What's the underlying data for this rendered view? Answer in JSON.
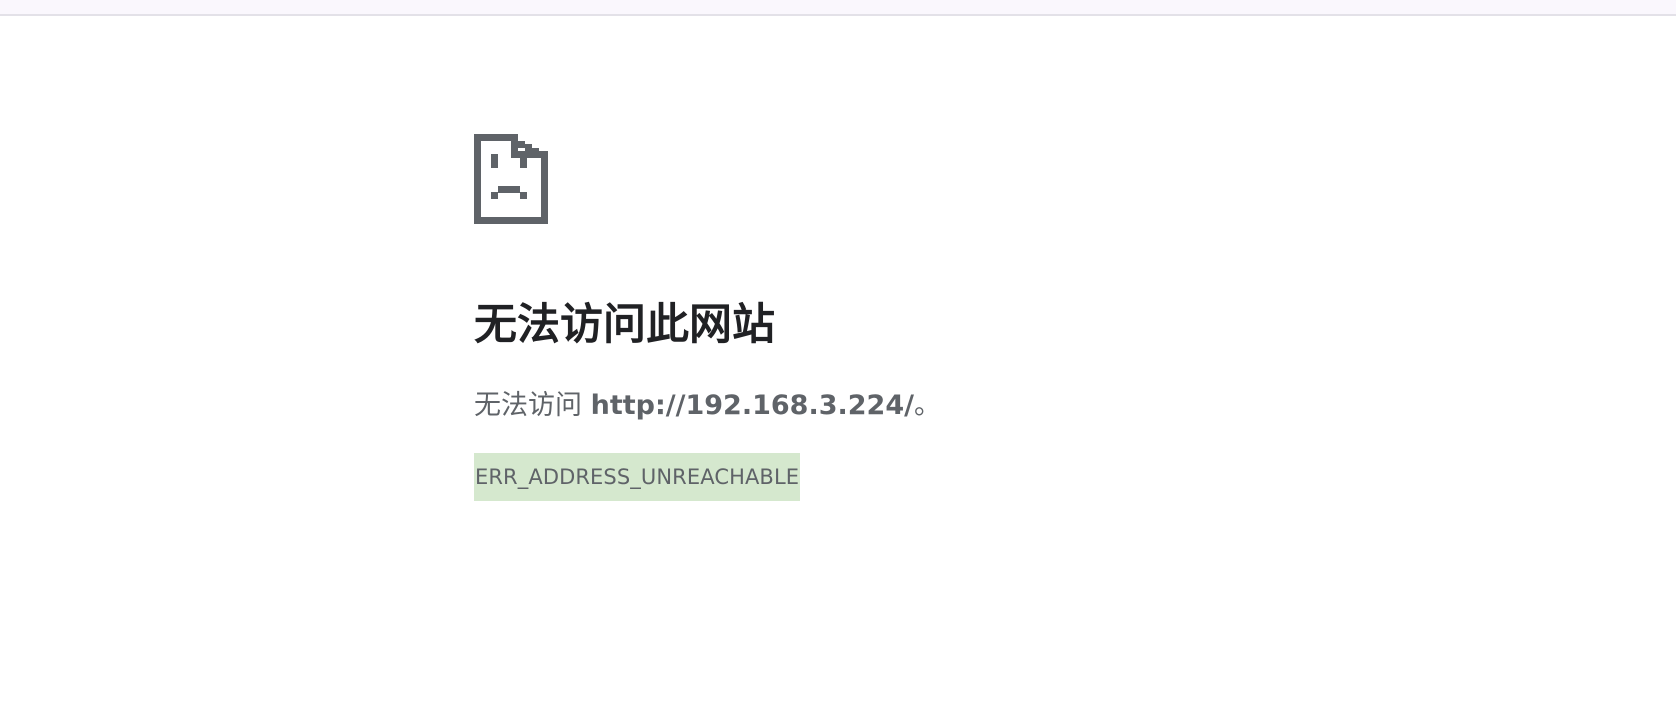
{
  "error_page": {
    "icon": "sad-page-icon",
    "title": "无法访问此网站",
    "message_prefix": "无法访问 ",
    "message_url": "http://192.168.3.224/",
    "message_suffix": "。",
    "error_code": "ERR_ADDRESS_UNREACHABLE"
  },
  "colors": {
    "icon": "#5f6368",
    "title": "#202124",
    "text": "#5f6368",
    "error_code_highlight": "#d5e8ce"
  }
}
